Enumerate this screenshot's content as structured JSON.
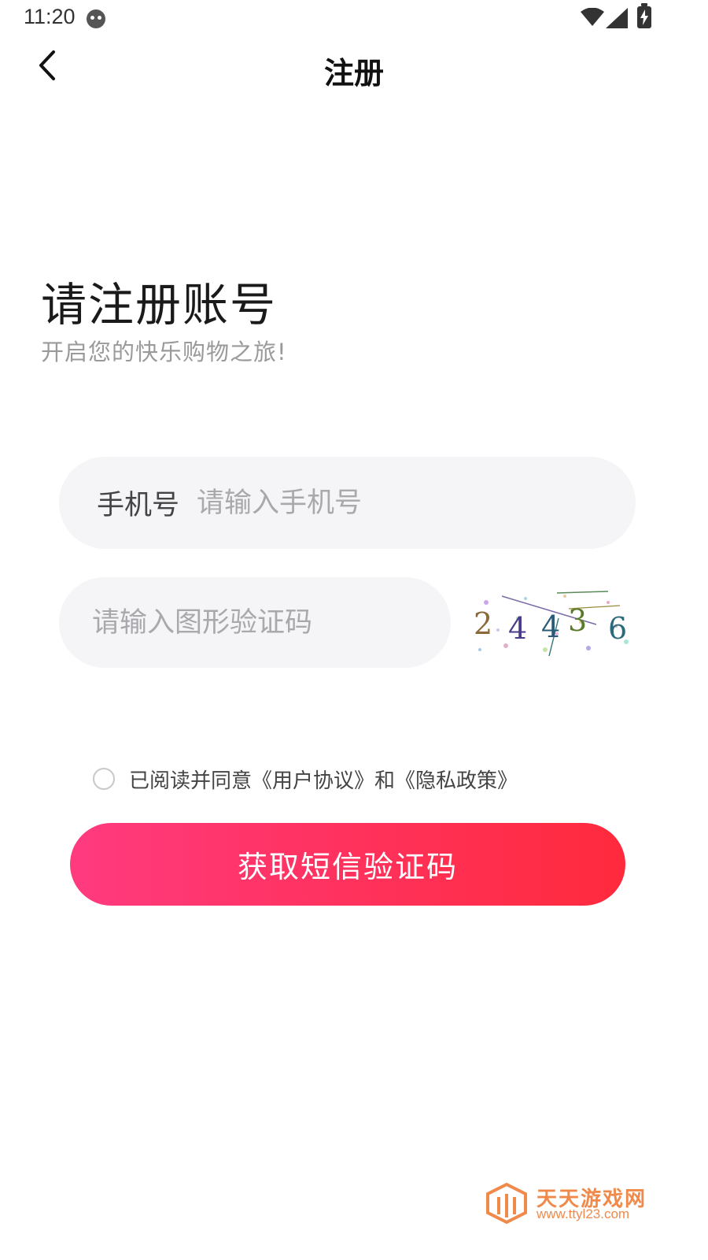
{
  "status_bar": {
    "time": "11:20"
  },
  "nav": {
    "title": "注册"
  },
  "heading": {
    "title": "请注册账号",
    "subtitle": "开启您的快乐购物之旅!"
  },
  "phone_field": {
    "label": "手机号",
    "placeholder": "请输入手机号",
    "value": ""
  },
  "captcha_field": {
    "placeholder": "请输入图形验证码",
    "value": ""
  },
  "captcha_image": {
    "code": "24436"
  },
  "agreement": {
    "text": "已阅读并同意《用户协议》和《隐私政策》",
    "checked": false
  },
  "submit": {
    "label": "获取短信验证码"
  },
  "watermark": {
    "title": "天天游戏网",
    "url": "www.ttyl23.com"
  },
  "colors": {
    "button_start": "#ff3a7f",
    "button_end": "#ff2a3c",
    "field_bg": "#f5f5f7",
    "watermark": "#f08a4b"
  }
}
